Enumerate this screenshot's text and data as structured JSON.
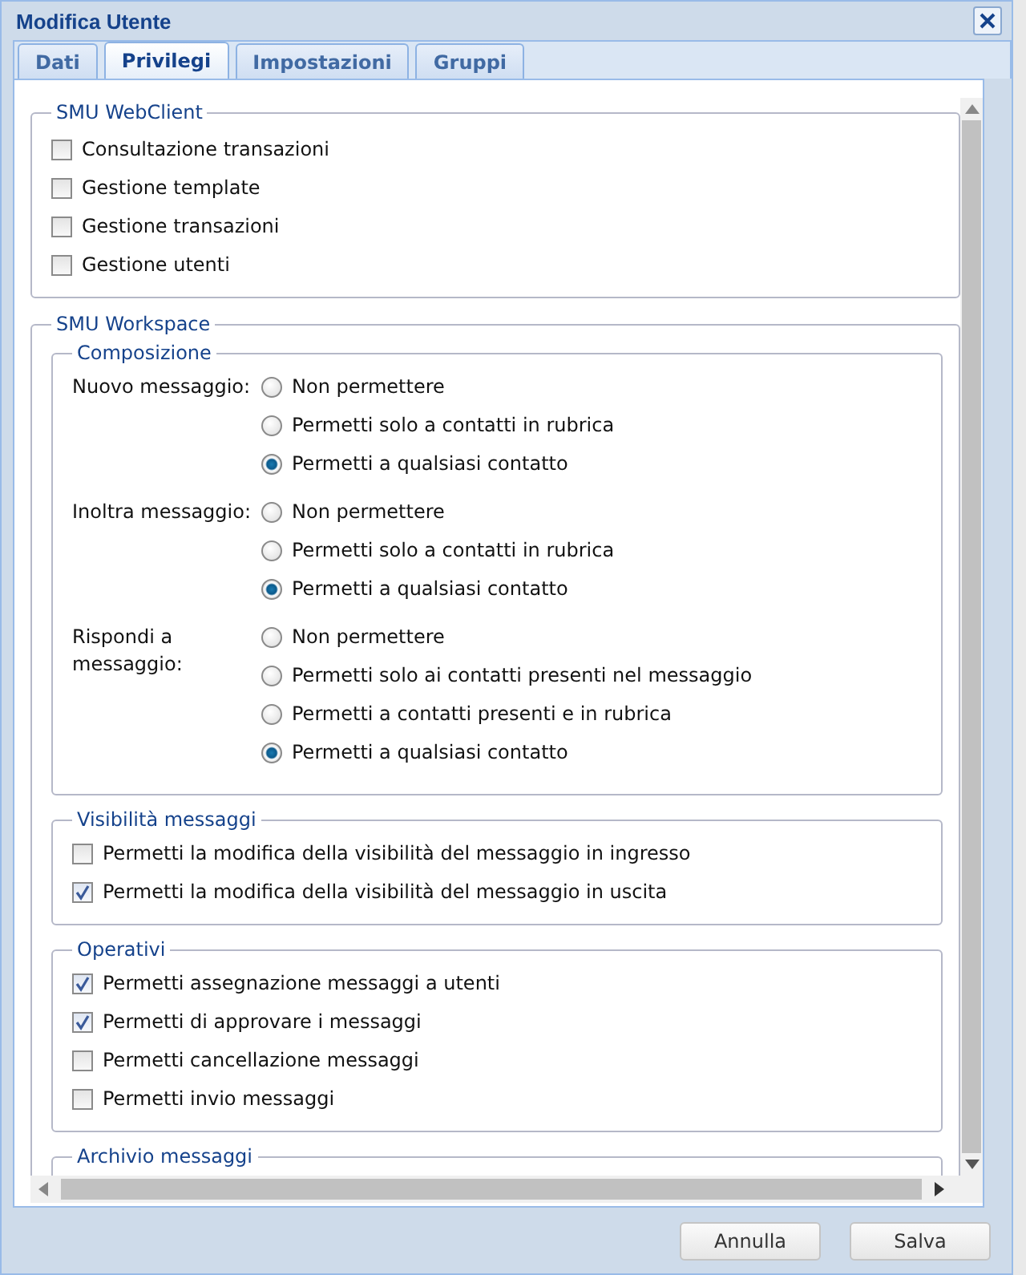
{
  "window": {
    "title": "Modifica Utente"
  },
  "tabs": [
    {
      "label": "Dati",
      "selected": false
    },
    {
      "label": "Privilegi",
      "selected": true
    },
    {
      "label": "Impostazioni",
      "selected": false
    },
    {
      "label": "Gruppi",
      "selected": false
    }
  ],
  "sections": [
    {
      "legend": "SMU WebClient",
      "kind": "checkboxes",
      "items": [
        {
          "label": "Consultazione transazioni",
          "checked": false
        },
        {
          "label": "Gestione template",
          "checked": false
        },
        {
          "label": "Gestione transazioni",
          "checked": false
        },
        {
          "label": "Gestione utenti",
          "checked": false
        }
      ]
    },
    {
      "legend": "SMU Workspace",
      "kind": "container",
      "subsections": [
        {
          "legend": "Composizione",
          "kind": "radio_groups",
          "groups": [
            {
              "label": "Nuovo messaggio:",
              "options": [
                {
                  "label": "Non permettere",
                  "selected": false
                },
                {
                  "label": "Permetti solo a contatti in rubrica",
                  "selected": false
                },
                {
                  "label": "Permetti a qualsiasi contatto",
                  "selected": true
                }
              ]
            },
            {
              "label": "Inoltra messaggio:",
              "options": [
                {
                  "label": "Non permettere",
                  "selected": false
                },
                {
                  "label": "Permetti solo a contatti in rubrica",
                  "selected": false
                },
                {
                  "label": "Permetti a qualsiasi contatto",
                  "selected": true
                }
              ]
            },
            {
              "label": "Rispondi a messaggio:",
              "options": [
                {
                  "label": "Non permettere",
                  "selected": false
                },
                {
                  "label": "Permetti solo ai contatti presenti nel messaggio",
                  "selected": false
                },
                {
                  "label": "Permetti a contatti presenti e in rubrica",
                  "selected": false
                },
                {
                  "label": "Permetti a qualsiasi contatto",
                  "selected": true
                }
              ]
            }
          ]
        },
        {
          "legend": "Visibilità messaggi",
          "kind": "checkboxes",
          "items": [
            {
              "label": "Permetti la modifica della visibilità del messaggio in ingresso",
              "checked": false
            },
            {
              "label": "Permetti la modifica della visibilità del messaggio in uscita",
              "checked": true
            }
          ]
        },
        {
          "legend": "Operativi",
          "kind": "checkboxes",
          "items": [
            {
              "label": "Permetti assegnazione messaggi a utenti",
              "checked": true
            },
            {
              "label": "Permetti di approvare i messaggi",
              "checked": true
            },
            {
              "label": "Permetti cancellazione messaggi",
              "checked": false
            },
            {
              "label": "Permetti invio messaggi",
              "checked": false
            }
          ]
        },
        {
          "legend": "Archivio messaggi",
          "kind": "checkboxes"
        }
      ]
    }
  ],
  "buttons": [
    {
      "label": "Annulla"
    },
    {
      "label": "Salva"
    }
  ]
}
